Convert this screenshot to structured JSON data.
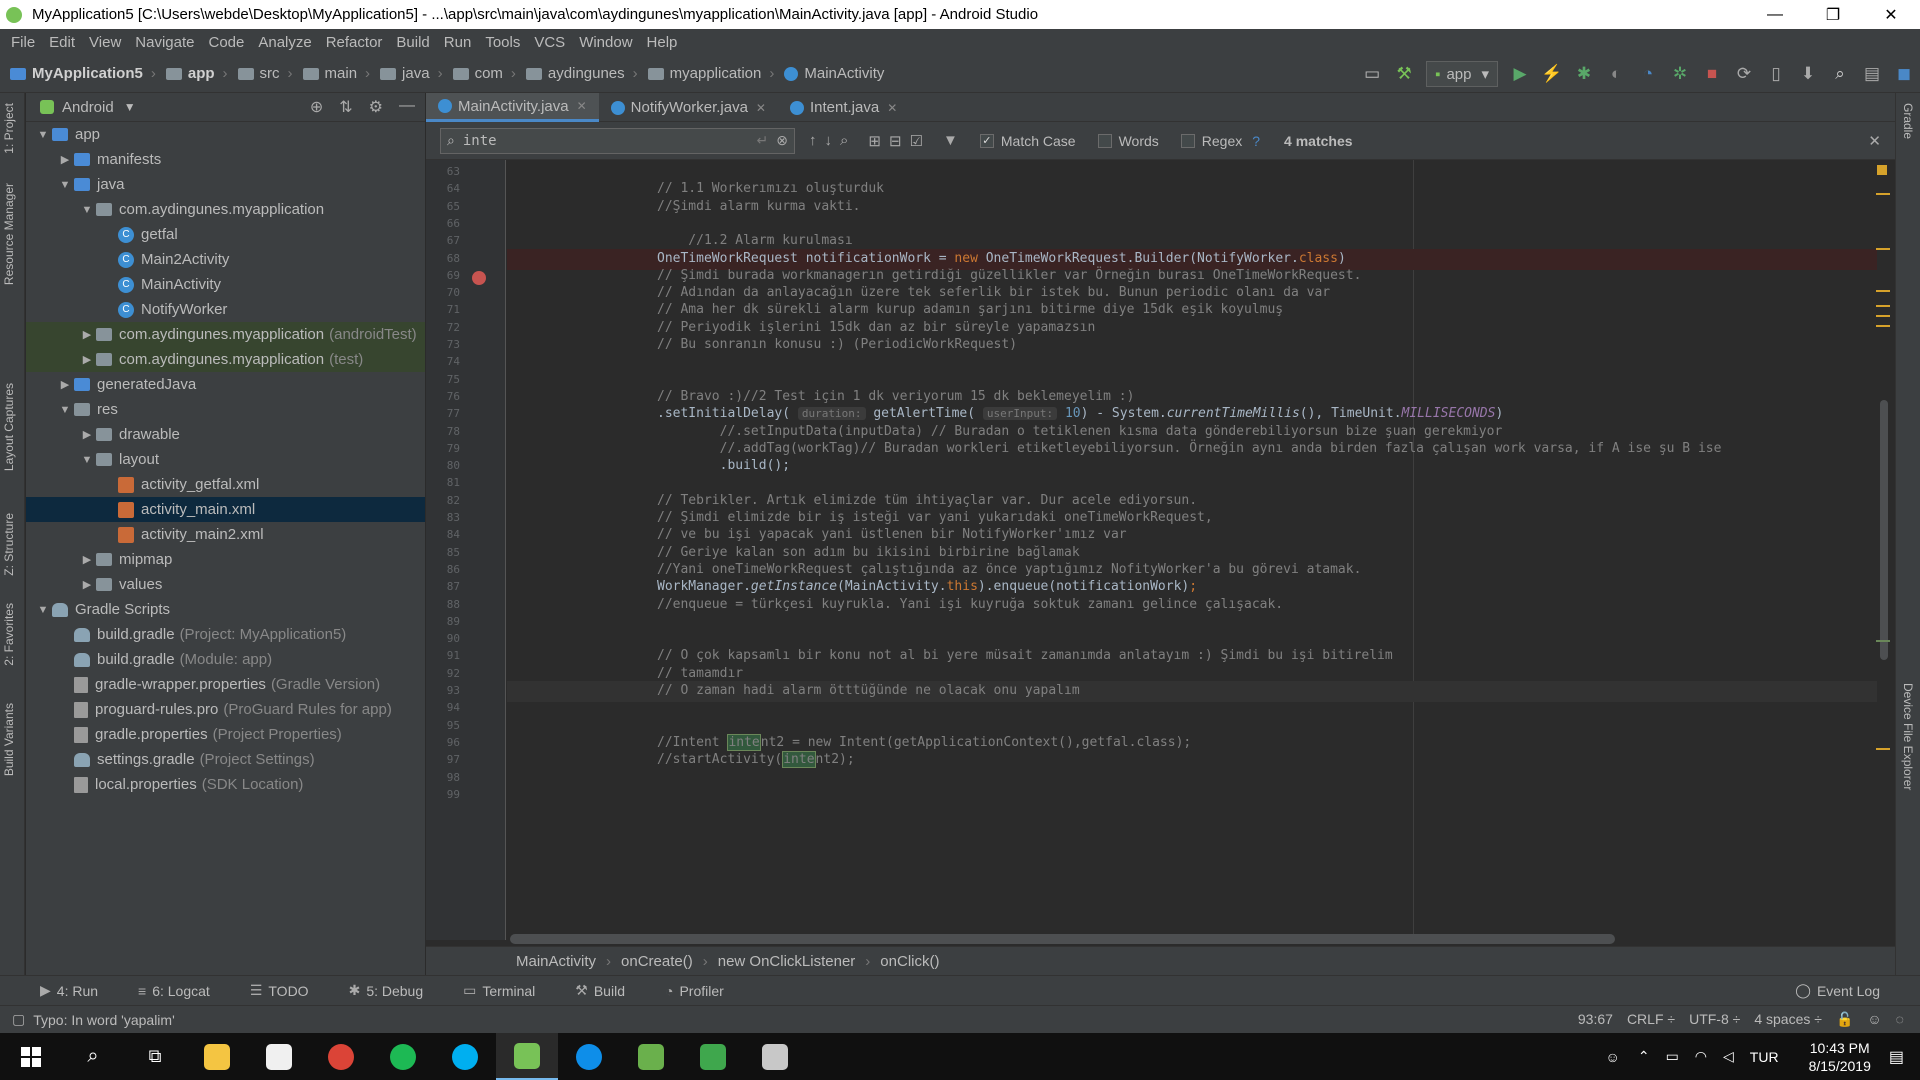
{
  "window": {
    "title": "MyApplication5 [C:\\Users\\webde\\Desktop\\MyApplication5] - ...\\app\\src\\main\\java\\com\\aydingunes\\myapplication\\MainActivity.java [app] - Android Studio",
    "minimize": "—",
    "restore": "❐",
    "close": "✕"
  },
  "menu": [
    "File",
    "Edit",
    "View",
    "Navigate",
    "Code",
    "Analyze",
    "Refactor",
    "Build",
    "Run",
    "Tools",
    "VCS",
    "Window",
    "Help"
  ],
  "nav": {
    "crumbs": [
      "MyApplication5",
      "app",
      "src",
      "main",
      "java",
      "com",
      "aydingunes",
      "myapplication",
      "MainActivity"
    ],
    "run_config": "app"
  },
  "left_tabs": [
    "1: Project",
    "Resource Manager",
    "Layout Captures",
    "Z: Structure",
    "2: Favorites",
    "Build Variants"
  ],
  "right_tabs": [
    "Gradle",
    "Device File Explorer"
  ],
  "project": {
    "view_mode": "Android",
    "tree": [
      {
        "label": "app",
        "extra": "",
        "depth": 0,
        "icon": "folder-blue",
        "arrow": "▼"
      },
      {
        "label": "manifests",
        "extra": "",
        "depth": 1,
        "icon": "folder-blue",
        "arrow": "▶"
      },
      {
        "label": "java",
        "extra": "",
        "depth": 1,
        "icon": "folder-blue",
        "arrow": "▼"
      },
      {
        "label": "com.aydingunes.myapplication",
        "extra": "",
        "depth": 2,
        "icon": "folder",
        "arrow": "▼"
      },
      {
        "label": "getfal",
        "extra": "",
        "depth": 3,
        "icon": "class",
        "arrow": ""
      },
      {
        "label": "Main2Activity",
        "extra": "",
        "depth": 3,
        "icon": "class",
        "arrow": ""
      },
      {
        "label": "MainActivity",
        "extra": "",
        "depth": 3,
        "icon": "class",
        "arrow": ""
      },
      {
        "label": "NotifyWorker",
        "extra": "",
        "depth": 3,
        "icon": "class",
        "arrow": ""
      },
      {
        "label": "com.aydingunes.myapplication",
        "extra": "(androidTest)",
        "depth": 2,
        "icon": "folder",
        "arrow": "▶",
        "test": true
      },
      {
        "label": "com.aydingunes.myapplication",
        "extra": "(test)",
        "depth": 2,
        "icon": "folder",
        "arrow": "▶",
        "test": true
      },
      {
        "label": "generatedJava",
        "extra": "",
        "depth": 1,
        "icon": "folder-blue",
        "arrow": "▶"
      },
      {
        "label": "res",
        "extra": "",
        "depth": 1,
        "icon": "folder",
        "arrow": "▼"
      },
      {
        "label": "drawable",
        "extra": "",
        "depth": 2,
        "icon": "folder",
        "arrow": "▶"
      },
      {
        "label": "layout",
        "extra": "",
        "depth": 2,
        "icon": "folder",
        "arrow": "▼"
      },
      {
        "label": "activity_getfal.xml",
        "extra": "",
        "depth": 3,
        "icon": "xml",
        "arrow": ""
      },
      {
        "label": "activity_main.xml",
        "extra": "",
        "depth": 3,
        "icon": "xml",
        "arrow": "",
        "selected": true
      },
      {
        "label": "activity_main2.xml",
        "extra": "",
        "depth": 3,
        "icon": "xml",
        "arrow": ""
      },
      {
        "label": "mipmap",
        "extra": "",
        "depth": 2,
        "icon": "folder",
        "arrow": "▶"
      },
      {
        "label": "values",
        "extra": "",
        "depth": 2,
        "icon": "folder",
        "arrow": "▶"
      },
      {
        "label": "Gradle Scripts",
        "extra": "",
        "depth": 0,
        "icon": "gradle",
        "arrow": "▼"
      },
      {
        "label": "build.gradle",
        "extra": "(Project: MyApplication5)",
        "depth": 1,
        "icon": "gradle",
        "arrow": ""
      },
      {
        "label": "build.gradle",
        "extra": "(Module: app)",
        "depth": 1,
        "icon": "gradle",
        "arrow": ""
      },
      {
        "label": "gradle-wrapper.properties",
        "extra": "(Gradle Version)",
        "depth": 1,
        "icon": "file",
        "arrow": ""
      },
      {
        "label": "proguard-rules.pro",
        "extra": "(ProGuard Rules for app)",
        "depth": 1,
        "icon": "file",
        "arrow": ""
      },
      {
        "label": "gradle.properties",
        "extra": "(Project Properties)",
        "depth": 1,
        "icon": "file",
        "arrow": ""
      },
      {
        "label": "settings.gradle",
        "extra": "(Project Settings)",
        "depth": 1,
        "icon": "gradle",
        "arrow": ""
      },
      {
        "label": "local.properties",
        "extra": "(SDK Location)",
        "depth": 1,
        "icon": "file",
        "arrow": ""
      }
    ]
  },
  "tabs": [
    "MainActivity.java",
    "NotifyWorker.java",
    "Intent.java"
  ],
  "find": {
    "query": "inte",
    "match_case": "Match Case",
    "words": "Words",
    "regex": "Regex",
    "help": "?",
    "matches": "4 matches"
  },
  "code_lines": [
    {
      "n": "63",
      "html": ""
    },
    {
      "n": "64",
      "html": "<span class='cm'>// 1.1 Workerımızı oluşturduk</span>"
    },
    {
      "n": "65",
      "html": "<span class='cm'>//Şimdi alarm kurma vakti.</span>"
    },
    {
      "n": "66",
      "html": ""
    },
    {
      "n": "67",
      "html": "<span class='cm'>    //1.2 Alarm kurulması</span>"
    },
    {
      "n": "68",
      "html": "OneTimeWorkRequest notificationWork = <span class='kw'>new</span> OneTimeWorkRequest.Builder(NotifyWorker.<span class='kw'>class</span>)"
    },
    {
      "n": "69",
      "html": "<span class='cm'>// Şimdi burada workmanagerın getirdiği güzellikler var Örneğin burası OneTimeWorkRequest.</span>"
    },
    {
      "n": "70",
      "html": "<span class='cm'>// Adından da anlayacağın üzere tek seferlik bir istek bu. Bunun periodic olanı da var</span>"
    },
    {
      "n": "71",
      "html": "<span class='cm'>// Ama her dk sürekli alarm kurup adamın şarjını bitirme diye 15dk eşik koyulmuş</span>"
    },
    {
      "n": "72",
      "html": "<span class='cm'>// Periyodik işlerini 15dk dan az bir süreyle yapamazsın</span>"
    },
    {
      "n": "73",
      "html": "<span class='cm'>// Bu sonranın konusu :) (PeriodicWorkRequest)</span>"
    },
    {
      "n": "74",
      "html": ""
    },
    {
      "n": "75",
      "html": ""
    },
    {
      "n": "76",
      "html": "<span class='cm'>// Bravo :)//2 Test için 1 dk veriyorum 15 dk beklemeyelim :)</span>"
    },
    {
      "n": "77",
      "html": ".setInitialDelay( <span class='hint'>duration:</span> getAlertTime( <span class='hint'>userInput:</span> <span class='num'>10</span>) - System.<span class='it'>currentTimeMillis</span>(), TimeUnit.<span class='purple'>MILLISECONDS</span>)"
    },
    {
      "n": "78",
      "html": "<span class='cm'>        //.setInputData(inputData) // Buradan o tetiklenen kısma data gönderebiliyorsun bize şuan gerekmiyor</span>"
    },
    {
      "n": "79",
      "html": "<span class='cm'>        //.addTag(workTag)// Buradan workleri etiketleyebiliyorsun. Örneğin aynı anda birden fazla çalışan work varsa, if A ise şu B ise</span>"
    },
    {
      "n": "80",
      "html": "        .build();"
    },
    {
      "n": "81",
      "html": ""
    },
    {
      "n": "82",
      "html": "<span class='cm'>// Tebrikler. Artık elimizde tüm ihtiyaçlar var. Dur acele ediyorsun.</span>"
    },
    {
      "n": "83",
      "html": "<span class='cm'>// Şimdi elimizde bir iş isteği var yani yukarıdaki oneTimeWorkRequest,</span>"
    },
    {
      "n": "84",
      "html": "<span class='cm'>// ve bu işi yapacak yani üstlenen bir NotifyWorker'ımız var</span>"
    },
    {
      "n": "85",
      "html": "<span class='cm'>// Geriye kalan son adım bu ikisini birbirine bağlamak</span>"
    },
    {
      "n": "86",
      "html": "<span class='cm'>//Yani oneTimeWorkRequest çalıştığında az önce yaptığımız NofityWorker'a bu görevi atamak.</span>"
    },
    {
      "n": "87",
      "html": "WorkManager.<span class='it'>getInstance</span>(MainActivity.<span class='kw'>this</span>).enqueue(notificationWork)<span class='kw'>;</span>"
    },
    {
      "n": "88",
      "html": "<span class='cm'>//enqueue = türkçesi kuyrukla. Yani işi kuyruğa soktuk zamanı gelince çalışacak.</span>"
    },
    {
      "n": "89",
      "html": ""
    },
    {
      "n": "90",
      "html": ""
    },
    {
      "n": "91",
      "html": "<span class='cm'>// O çok kapsamlı bir konu not al bi yere müsait zamanımda anlatayım :) Şimdi bu işi bitirelim</span>"
    },
    {
      "n": "92",
      "html": "<span class='cm'>// tamamdır</span>"
    },
    {
      "n": "93",
      "html": "<span class='cm'>// O zaman hadi alarm ötttüğünde ne olacak onu yapalım</span>"
    },
    {
      "n": "94",
      "html": ""
    },
    {
      "n": "95",
      "html": ""
    },
    {
      "n": "96",
      "html": "<span class='cm'>//Intent <span class='hl'>inte</span>nt2 = new Intent(getApplicationContext(),getfal.class);</span>"
    },
    {
      "n": "97",
      "html": "<span class='cm'>//startActivity(<span class='hl'>inte</span>nt2);</span>"
    },
    {
      "n": "98",
      "html": ""
    },
    {
      "n": "99",
      "html": ""
    }
  ],
  "breadcrumbs": [
    "MainActivity",
    "onCreate()",
    "new OnClickListener",
    "onClick()"
  ],
  "toolwindows": [
    {
      "label": "4: Run",
      "icon": "▶"
    },
    {
      "label": "6: Logcat",
      "icon": "≡"
    },
    {
      "label": "TODO",
      "icon": "☰"
    },
    {
      "label": "5: Debug",
      "icon": "✱"
    },
    {
      "label": "Terminal",
      "icon": "▭"
    },
    {
      "label": "Build",
      "icon": "⚒"
    },
    {
      "label": "Profiler",
      "icon": "◔"
    }
  ],
  "event_log": "Event Log",
  "status": {
    "message": "Typo: In word 'yapalim'",
    "position": "93:67",
    "line_sep": "CRLF ÷",
    "encoding": "UTF-8 ÷",
    "indent": "4 spaces ÷"
  },
  "taskbar": {
    "apps": [
      {
        "name": "file-explorer-icon",
        "color": "#f4c542"
      },
      {
        "name": "mail-icon",
        "color": "#f0f0f0"
      },
      {
        "name": "chrome-icon",
        "color": "#db4437"
      },
      {
        "name": "spotify-icon",
        "color": "#1db954"
      },
      {
        "name": "skype-icon",
        "color": "#00aff0"
      },
      {
        "name": "android-studio-icon",
        "color": "#78c257",
        "active": true
      },
      {
        "name": "teamviewer-icon",
        "color": "#0e8ee9"
      },
      {
        "name": "excel-icon",
        "color": "#6ab04c"
      },
      {
        "name": "sheets-icon",
        "color": "#3fa74d"
      },
      {
        "name": "misc-app-icon",
        "color": "#c8c8c8"
      }
    ],
    "lang": "TUR",
    "time": "10:43 PM",
    "date": "8/15/2019"
  },
  "colors": {
    "accent": "#4a88c7",
    "breakpoint": "#c75450",
    "comment": "#808080",
    "keyword": "#cc7832"
  }
}
